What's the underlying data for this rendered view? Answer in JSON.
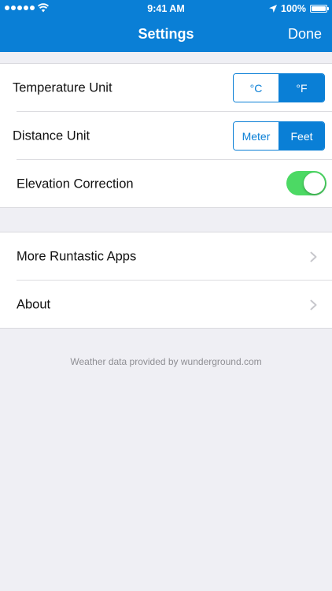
{
  "status_bar": {
    "time": "9:41 AM",
    "battery": "100%",
    "battery_level": 1.0
  },
  "nav": {
    "title": "Settings",
    "done_label": "Done"
  },
  "settings": {
    "temperature": {
      "label": "Temperature Unit",
      "options": [
        "°C",
        "°F"
      ],
      "selected": "°F"
    },
    "distance": {
      "label": "Distance Unit",
      "options": [
        "Meter",
        "Feet"
      ],
      "selected": "Feet"
    },
    "elevation": {
      "label": "Elevation Correction",
      "enabled": true
    }
  },
  "links": {
    "more_apps": "More Runtastic Apps",
    "about": "About"
  },
  "footer": "Weather data provided by wunderground.com",
  "colors": {
    "accent": "#0a7fd6",
    "toggle_on": "#4cd964",
    "background": "#efeff4"
  }
}
